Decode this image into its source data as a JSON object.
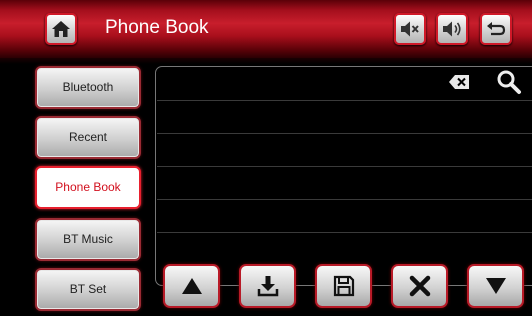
{
  "header": {
    "title": "Phone Book",
    "icons": [
      "home-icon",
      "mute-icon",
      "volume-icon",
      "back-icon"
    ]
  },
  "sidebar": {
    "items": [
      {
        "label": "Bluetooth",
        "active": false
      },
      {
        "label": "Recent",
        "active": false
      },
      {
        "label": "Phone Book",
        "active": true
      },
      {
        "label": "BT Music",
        "active": false
      },
      {
        "label": "BT Set",
        "active": false
      }
    ]
  },
  "panel": {
    "icons": [
      "backspace-icon",
      "search-icon"
    ]
  },
  "toolbar": {
    "icons": [
      "up-arrow-icon",
      "download-icon",
      "save-icon",
      "delete-icon",
      "down-arrow-icon"
    ]
  },
  "colors": {
    "accent": "#c81e2c",
    "active_text": "#d2101e"
  }
}
